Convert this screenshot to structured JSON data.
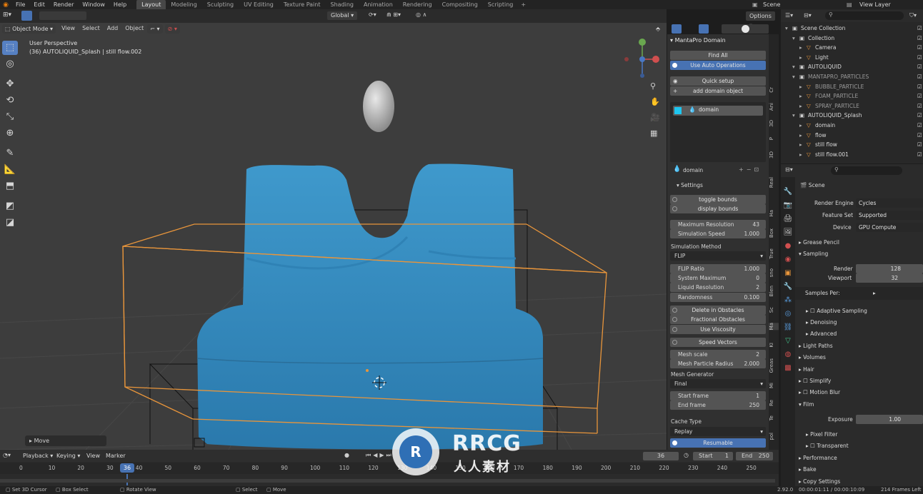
{
  "topbar": {
    "menus": [
      "File",
      "Edit",
      "Render",
      "Window",
      "Help"
    ],
    "workspaces": [
      "Layout",
      "Modeling",
      "Sculpting",
      "UV Editing",
      "Texture Paint",
      "Shading",
      "Animation",
      "Rendering",
      "Compositing",
      "Scripting"
    ],
    "active_workspace": "Layout",
    "scene": "Scene",
    "view_layer": "View Layer"
  },
  "viewport_header": {
    "mode": "Object Mode",
    "menus": [
      "View",
      "Select",
      "Add",
      "Object"
    ],
    "orientation": "Global",
    "options": "Options"
  },
  "viewport": {
    "perspective": "User Perspective",
    "object_info": "(36) AUTOLIQUID_Splash | still flow.002",
    "last_op": "Move",
    "fluid_color": "#3a8fc0",
    "domain_color": "#e8953b"
  },
  "manta": {
    "title": "MantaPro Domain",
    "find_all": "Find All",
    "use_auto": "Use Auto Operations",
    "quick_setup": "Quick setup",
    "add_domain": "add domain object",
    "list_item": "domain",
    "domain_label": "domain",
    "settings": "Settings",
    "toggle_bounds": "toggle bounds",
    "display_bounds": "display bounds",
    "max_res_label": "Maximum Resolution",
    "max_res": "43",
    "sim_speed_label": "Simulation Speed",
    "sim_speed": "1.000",
    "sim_method_label": "Simulation Method",
    "sim_method": "FLIP",
    "flip_ratio_label": "FLIP Ratio",
    "flip_ratio": "1.000",
    "system_max_label": "System Maximum",
    "system_max": "0",
    "liquid_res_label": "Liquid Resolution",
    "liquid_res": "2",
    "randomness_label": "Randomness",
    "randomness": "0.100",
    "delete_obstacles": "Delete in Obstacles",
    "fractional_obstacles": "Fractional Obstacles",
    "use_viscosity": "Use Viscosity",
    "speed_vectors": "Speed Vectors",
    "mesh_scale_label": "Mesh scale",
    "mesh_scale": "2",
    "mesh_particle_label": "Mesh Particle Radius",
    "mesh_particle": "2.000",
    "mesh_gen_label": "Mesh Generator",
    "mesh_gen": "Final",
    "start_frame_label": "Start frame",
    "start_frame": "1",
    "end_frame_label": "End frame",
    "end_frame": "250",
    "cache_type_label": "Cache Type",
    "cache_type": "Replay",
    "resumable": "Resumable"
  },
  "vtabs": [
    "Cr",
    "Ani",
    "3D",
    "P",
    "3D",
    "Real",
    "Ha",
    "Box",
    "True",
    "sno",
    "Blen",
    "Sc",
    "Ma",
    "KI",
    "Greas",
    "Mi",
    "Re",
    "Te",
    "pol"
  ],
  "outliner": {
    "rows": [
      {
        "label": "Scene Collection",
        "indent": 0,
        "dim": false,
        "sel": false
      },
      {
        "label": "Collection",
        "indent": 1,
        "dim": false,
        "sel": false
      },
      {
        "label": "Camera",
        "indent": 2,
        "dim": false,
        "sel": false
      },
      {
        "label": "Light",
        "indent": 2,
        "dim": false,
        "sel": false
      },
      {
        "label": "AUTOLIQUID",
        "indent": 1,
        "dim": false,
        "sel": false
      },
      {
        "label": "MANTAPRO_PARTICLES",
        "indent": 1,
        "dim": true,
        "sel": false
      },
      {
        "label": "BUBBLE_PARTICLE",
        "indent": 2,
        "dim": true,
        "sel": false
      },
      {
        "label": "FOAM_PARTICLE",
        "indent": 2,
        "dim": true,
        "sel": false
      },
      {
        "label": "SPRAY_PARTICLE",
        "indent": 2,
        "dim": true,
        "sel": false
      },
      {
        "label": "AUTOLIQUID_Splash",
        "indent": 1,
        "dim": false,
        "sel": false
      },
      {
        "label": "domain",
        "indent": 2,
        "dim": false,
        "sel": false
      },
      {
        "label": "flow",
        "indent": 2,
        "dim": false,
        "sel": false
      },
      {
        "label": "still flow",
        "indent": 2,
        "dim": false,
        "sel": false
      },
      {
        "label": "still flow.001",
        "indent": 2,
        "dim": false,
        "sel": false
      }
    ]
  },
  "props": {
    "scene": "Scene",
    "render_engine_label": "Render Engine",
    "render_engine": "Cycles",
    "feature_set_label": "Feature Set",
    "feature_set": "Supported",
    "device_label": "Device",
    "device": "GPU Compute",
    "grease_pencil": "Grease Pencil",
    "sampling": "Sampling",
    "render_label": "Render",
    "render": "128",
    "viewport_label": "Viewport",
    "viewport": "32",
    "samples_per": "Samples Per:",
    "adaptive": "Adaptive Sampling",
    "denoising": "Denoising",
    "advanced": "Advanced",
    "light_paths": "Light Paths",
    "volumes": "Volumes",
    "hair": "Hair",
    "simplify": "Simplify",
    "motion_blur": "Motion Blur",
    "film": "Film",
    "exposure_label": "Exposure",
    "exposure": "1.00",
    "pixel_filter": "Pixel Filter",
    "transparent": "Transparent",
    "performance": "Performance",
    "bake": "Bake",
    "copy_settings": "Copy Settings"
  },
  "timeline": {
    "menus": [
      "Playback",
      "Keying",
      "View",
      "Marker"
    ],
    "current_frame": "36",
    "start_label": "Start",
    "start": "1",
    "end_label": "End",
    "end": "250",
    "ticks": [
      "0",
      "10",
      "20",
      "30",
      "40",
      "50",
      "60",
      "70",
      "80",
      "90",
      "100",
      "110",
      "120",
      "130",
      "140",
      "150",
      "160",
      "170",
      "180",
      "190",
      "200",
      "210",
      "220",
      "230",
      "240",
      "250"
    ]
  },
  "statusbar": {
    "set_cursor": "Set 3D Cursor",
    "box_select": "Box Select",
    "rotate_view": "Rotate View",
    "select": "Select",
    "move": "Move",
    "version": "2.92.0",
    "time": "00:00:01:11 / 00:00:10:09",
    "frames_left": "214 Frames Left"
  },
  "watermark": {
    "brand": "RRCG",
    "sub": "人人素材"
  }
}
